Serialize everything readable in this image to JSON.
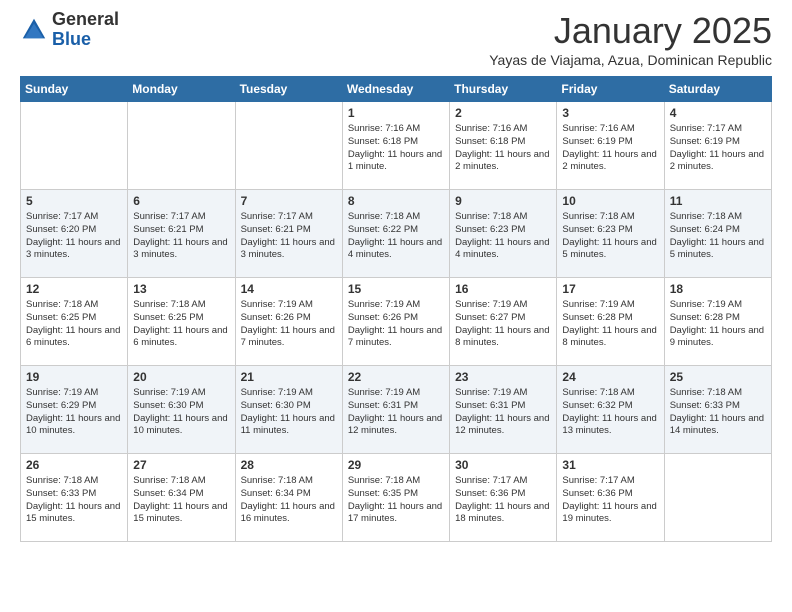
{
  "logo": {
    "general": "General",
    "blue": "Blue"
  },
  "header": {
    "month": "January 2025",
    "location": "Yayas de Viajama, Azua, Dominican Republic"
  },
  "days_of_week": [
    "Sunday",
    "Monday",
    "Tuesday",
    "Wednesday",
    "Thursday",
    "Friday",
    "Saturday"
  ],
  "weeks": [
    [
      {
        "day": "",
        "content": ""
      },
      {
        "day": "",
        "content": ""
      },
      {
        "day": "",
        "content": ""
      },
      {
        "day": "1",
        "content": "Sunrise: 7:16 AM\nSunset: 6:18 PM\nDaylight: 11 hours and 1 minute."
      },
      {
        "day": "2",
        "content": "Sunrise: 7:16 AM\nSunset: 6:18 PM\nDaylight: 11 hours and 2 minutes."
      },
      {
        "day": "3",
        "content": "Sunrise: 7:16 AM\nSunset: 6:19 PM\nDaylight: 11 hours and 2 minutes."
      },
      {
        "day": "4",
        "content": "Sunrise: 7:17 AM\nSunset: 6:19 PM\nDaylight: 11 hours and 2 minutes."
      }
    ],
    [
      {
        "day": "5",
        "content": "Sunrise: 7:17 AM\nSunset: 6:20 PM\nDaylight: 11 hours and 3 minutes."
      },
      {
        "day": "6",
        "content": "Sunrise: 7:17 AM\nSunset: 6:21 PM\nDaylight: 11 hours and 3 minutes."
      },
      {
        "day": "7",
        "content": "Sunrise: 7:17 AM\nSunset: 6:21 PM\nDaylight: 11 hours and 3 minutes."
      },
      {
        "day": "8",
        "content": "Sunrise: 7:18 AM\nSunset: 6:22 PM\nDaylight: 11 hours and 4 minutes."
      },
      {
        "day": "9",
        "content": "Sunrise: 7:18 AM\nSunset: 6:23 PM\nDaylight: 11 hours and 4 minutes."
      },
      {
        "day": "10",
        "content": "Sunrise: 7:18 AM\nSunset: 6:23 PM\nDaylight: 11 hours and 5 minutes."
      },
      {
        "day": "11",
        "content": "Sunrise: 7:18 AM\nSunset: 6:24 PM\nDaylight: 11 hours and 5 minutes."
      }
    ],
    [
      {
        "day": "12",
        "content": "Sunrise: 7:18 AM\nSunset: 6:25 PM\nDaylight: 11 hours and 6 minutes."
      },
      {
        "day": "13",
        "content": "Sunrise: 7:18 AM\nSunset: 6:25 PM\nDaylight: 11 hours and 6 minutes."
      },
      {
        "day": "14",
        "content": "Sunrise: 7:19 AM\nSunset: 6:26 PM\nDaylight: 11 hours and 7 minutes."
      },
      {
        "day": "15",
        "content": "Sunrise: 7:19 AM\nSunset: 6:26 PM\nDaylight: 11 hours and 7 minutes."
      },
      {
        "day": "16",
        "content": "Sunrise: 7:19 AM\nSunset: 6:27 PM\nDaylight: 11 hours and 8 minutes."
      },
      {
        "day": "17",
        "content": "Sunrise: 7:19 AM\nSunset: 6:28 PM\nDaylight: 11 hours and 8 minutes."
      },
      {
        "day": "18",
        "content": "Sunrise: 7:19 AM\nSunset: 6:28 PM\nDaylight: 11 hours and 9 minutes."
      }
    ],
    [
      {
        "day": "19",
        "content": "Sunrise: 7:19 AM\nSunset: 6:29 PM\nDaylight: 11 hours and 10 minutes."
      },
      {
        "day": "20",
        "content": "Sunrise: 7:19 AM\nSunset: 6:30 PM\nDaylight: 11 hours and 10 minutes."
      },
      {
        "day": "21",
        "content": "Sunrise: 7:19 AM\nSunset: 6:30 PM\nDaylight: 11 hours and 11 minutes."
      },
      {
        "day": "22",
        "content": "Sunrise: 7:19 AM\nSunset: 6:31 PM\nDaylight: 11 hours and 12 minutes."
      },
      {
        "day": "23",
        "content": "Sunrise: 7:19 AM\nSunset: 6:31 PM\nDaylight: 11 hours and 12 minutes."
      },
      {
        "day": "24",
        "content": "Sunrise: 7:18 AM\nSunset: 6:32 PM\nDaylight: 11 hours and 13 minutes."
      },
      {
        "day": "25",
        "content": "Sunrise: 7:18 AM\nSunset: 6:33 PM\nDaylight: 11 hours and 14 minutes."
      }
    ],
    [
      {
        "day": "26",
        "content": "Sunrise: 7:18 AM\nSunset: 6:33 PM\nDaylight: 11 hours and 15 minutes."
      },
      {
        "day": "27",
        "content": "Sunrise: 7:18 AM\nSunset: 6:34 PM\nDaylight: 11 hours and 15 minutes."
      },
      {
        "day": "28",
        "content": "Sunrise: 7:18 AM\nSunset: 6:34 PM\nDaylight: 11 hours and 16 minutes."
      },
      {
        "day": "29",
        "content": "Sunrise: 7:18 AM\nSunset: 6:35 PM\nDaylight: 11 hours and 17 minutes."
      },
      {
        "day": "30",
        "content": "Sunrise: 7:17 AM\nSunset: 6:36 PM\nDaylight: 11 hours and 18 minutes."
      },
      {
        "day": "31",
        "content": "Sunrise: 7:17 AM\nSunset: 6:36 PM\nDaylight: 11 hours and 19 minutes."
      },
      {
        "day": "",
        "content": ""
      }
    ]
  ]
}
